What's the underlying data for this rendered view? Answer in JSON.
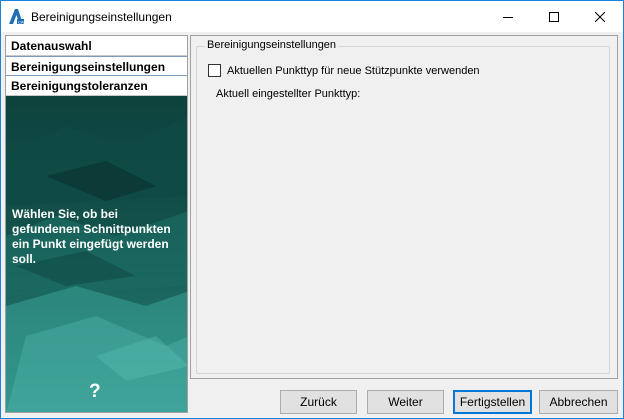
{
  "window": {
    "title": "Bereinigungseinstellungen"
  },
  "nav": {
    "items": [
      {
        "label": "Datenauswahl"
      },
      {
        "label": "Bereinigungseinstellungen"
      },
      {
        "label": "Bereinigungstoleranzen"
      }
    ],
    "active_index": 1
  },
  "left_panel": {
    "hint": "Wählen Sie, ob bei gefundenen Schnittpunkten ein Punkt eingefügt werden soll.",
    "help": "?"
  },
  "settings": {
    "group_title": "Bereinigungseinstellungen",
    "checkbox_label": "Aktuellen Punkttyp für neue Stützpunkte verwenden",
    "checkbox_checked": false,
    "current_type_label": "Aktuell eingestellter Punkttyp:"
  },
  "footer": {
    "back": "Zurück",
    "next": "Weiter",
    "finish": "Fertigstellen",
    "cancel": "Abbrechen"
  },
  "colors": {
    "accent": "#0078d7",
    "panel_bg": "#0e3b37"
  }
}
